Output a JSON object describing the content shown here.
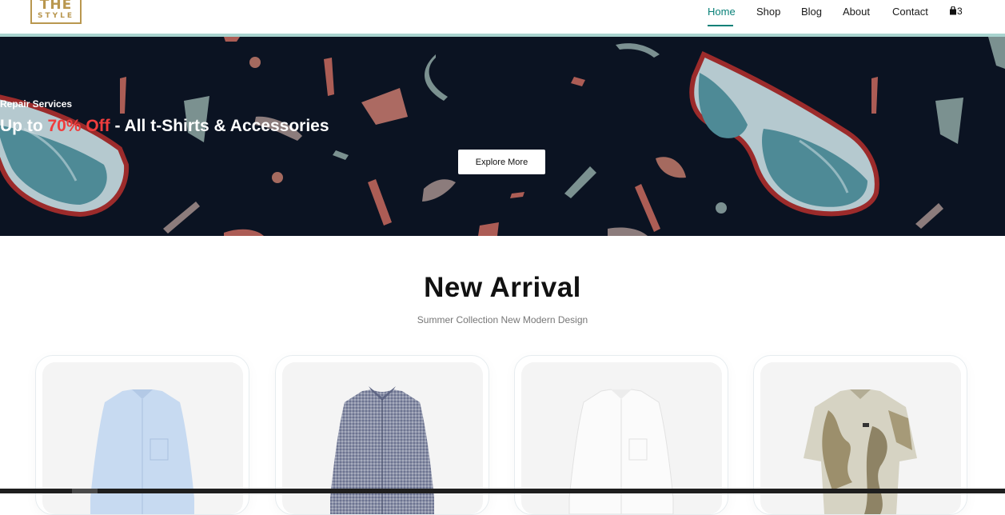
{
  "brand": {
    "logo_line1": "THE",
    "logo_line2": "STYLE"
  },
  "nav": {
    "items": [
      {
        "label": "Home",
        "active": true
      },
      {
        "label": "Shop"
      },
      {
        "label": "Blog"
      },
      {
        "label": "About"
      },
      {
        "label": "Contact"
      }
    ],
    "cart_count": "3",
    "cart_icon": "shopping-bag-icon"
  },
  "hero": {
    "subtitle": "Repair Services",
    "headline_prefix": "Up to ",
    "headline_highlight": "70% Off",
    "headline_suffix": " - All t-Shirts & Accessories",
    "button_label": "Explore More"
  },
  "section": {
    "title": "New Arrival",
    "subtitle": "Summer Collection New Modern Design"
  },
  "products": [
    {
      "image": "light-blue-shirt"
    },
    {
      "image": "checked-shirt"
    },
    {
      "image": "white-shirt"
    },
    {
      "image": "printed-shirt"
    }
  ],
  "colors": {
    "accent": "#088178",
    "banner_bg": "#0b1322",
    "highlight": "#ef3d3d",
    "logo_gold": "#b9974f"
  }
}
